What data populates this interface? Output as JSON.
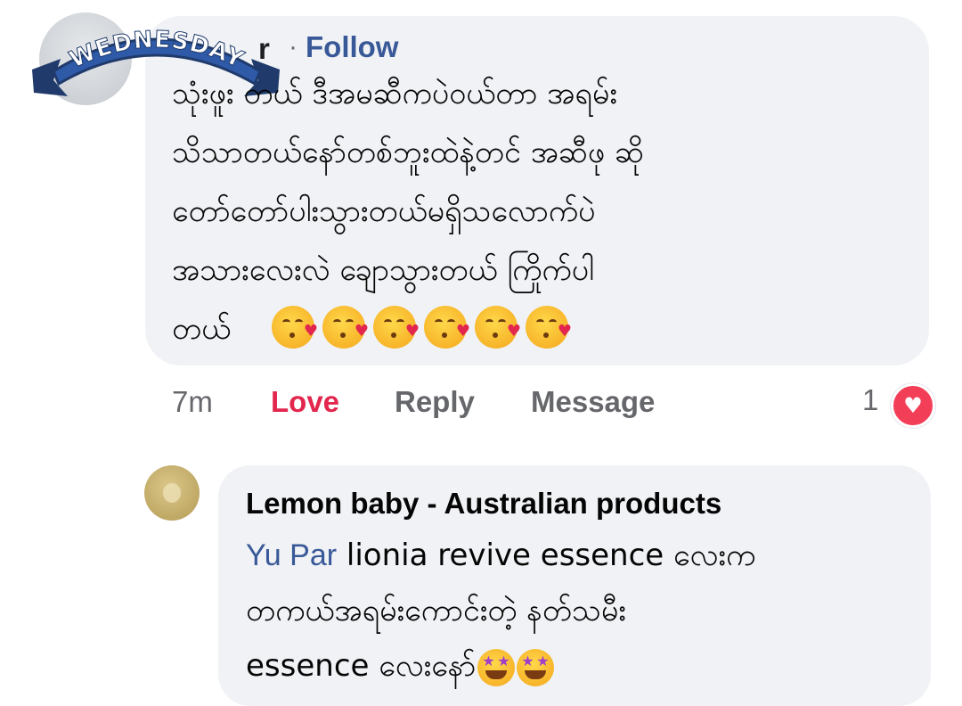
{
  "overlay": {
    "banner_text": "WEDNESDAY"
  },
  "comment1": {
    "author_partial": "r",
    "separator": "·",
    "follow_label": "Follow",
    "lines": [
      "သုံးဖူး တယ် ဒီအမဆီကပဲဝယ်တာ အရမ်း",
      "သိသာတယ်နော်တစ်ဘူးထဲနဲ့တင် အဆီဖု ဆို",
      "တော်တော်ပါးသွားတယ်မရှိသလောက်ပဲ",
      "အသားလေးလဲ ချောသွားတယ် ကြိုက်ပါ",
      "တယ်"
    ],
    "emoji": "face-blowing-a-kiss",
    "emoji_count": 6,
    "time": "7m",
    "love_label": "Love",
    "reply_label": "Reply",
    "message_label": "Message",
    "reaction_count": "1",
    "reaction_icon": "heart-icon",
    "reaction_color": "#f33e58"
  },
  "comment2": {
    "author": "Lemon baby - Australian products",
    "mention": "Yu Par",
    "line1_rest": " lionia revive essence လေးက",
    "line2": "တကယ်အရမ်းကောင်းတဲ့ နတ်သမီး",
    "line3": "essence လေးနော်",
    "emoji": "star-struck",
    "emoji_count": 2
  },
  "colors": {
    "bubble": "#f0f2f5",
    "link": "#385898",
    "love": "#e2264d",
    "meta": "#65676b"
  }
}
